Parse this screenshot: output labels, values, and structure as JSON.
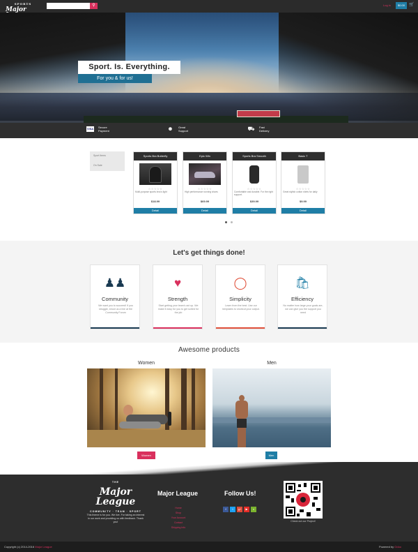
{
  "header": {
    "logo_main": "Major League",
    "logo_tagline": "SPORTS",
    "search_placeholder": "",
    "search_icon": "search-icon",
    "login_label": "Log in",
    "cart_amount": "$0.00",
    "cart_icon": "cart-icon"
  },
  "hero": {
    "headline": "Sport. Is. Everything.",
    "subline": "For you & for us!"
  },
  "features": [
    {
      "icon": "visa-card-icon",
      "line1": "Secure",
      "line2": "Payment"
    },
    {
      "icon": "people-icon",
      "line1": "Great",
      "line2": "Support"
    },
    {
      "icon": "truck-icon",
      "line1": "Fast",
      "line2": "Delivery"
    }
  ],
  "sidebar": {
    "items": [
      "Sport Items",
      "On Sale"
    ]
  },
  "products": [
    {
      "title": "Sports Bra Butterfly",
      "desc": "Multi-purpose sports bra is light",
      "price": "$18.99",
      "button": "Detail"
    },
    {
      "title": "Epic Win",
      "desc": "High performance running shoes",
      "price": "$69.99",
      "button": "Detail"
    },
    {
      "title": "Sports Bra Smooth",
      "desc": "Comfortable and durable. For the right support.",
      "price": "$39.99",
      "button": "Detail"
    },
    {
      "title": "Basic T",
      "desc": "Great stylish cotton shirts for daily",
      "price": "$9.99",
      "button": "Detail"
    }
  ],
  "gtd": {
    "title": "Let's get things done!",
    "boxes": [
      {
        "icon": "community-icon",
        "title": "Community",
        "desc": "We want you to succeed! If you struggle, shoot us a line at the Community Forum",
        "color": "#1a3a52"
      },
      {
        "icon": "heartbeat-icon",
        "title": "Strength",
        "desc": "Start getting your team's act up. We make it easy for you to get sorted for the job",
        "color": "#d9305d"
      },
      {
        "icon": "lightbulb-icon",
        "title": "Simplicity",
        "desc": "Learn from the best. Use our templates to shortcut your output.",
        "color": "#e0503a"
      },
      {
        "icon": "shopping-bag-icon",
        "title": "Efficiency",
        "desc": "No matter how large your goals are, we can give you the support you need",
        "color": "#1f7ea6"
      }
    ]
  },
  "awesome": {
    "title": "Awesome products",
    "women_label": "Women",
    "men_label": "Men",
    "women_button": "Women",
    "men_button": "Men"
  },
  "footer": {
    "logo_main": "Major League",
    "logo_tag_top": "THE",
    "logo_tag_bottom": "COMMUNITY · TEAM · SPORT",
    "about_pre": "This theme is for you. We live. For taking an interest in our work and providing us with feedback. Thank you!",
    "ml_title": "Major League",
    "links": [
      "Home",
      "Shop",
      "Your Account",
      "Contact",
      "Shipping Info"
    ],
    "follow_title": "Follow Us!",
    "social": [
      {
        "icon": "facebook-icon",
        "glyph": "f",
        "color": "#3b5998"
      },
      {
        "icon": "twitter-icon",
        "glyph": "t",
        "color": "#1da1f2"
      },
      {
        "icon": "googleplus-icon",
        "glyph": "g+",
        "color": "#dd4b39"
      },
      {
        "icon": "youtube-icon",
        "glyph": "▶",
        "color": "#e52d27"
      },
      {
        "icon": "vine-icon",
        "glyph": "v",
        "color": "#7bb32e"
      }
    ],
    "qr_caption": "Check out our Project!"
  },
  "bottom": {
    "copyright_pre": "Copyright (c) 2014-2016",
    "copyright_link": "Major League",
    "powered_pre": "Powered by",
    "powered_link": "Odoo"
  }
}
